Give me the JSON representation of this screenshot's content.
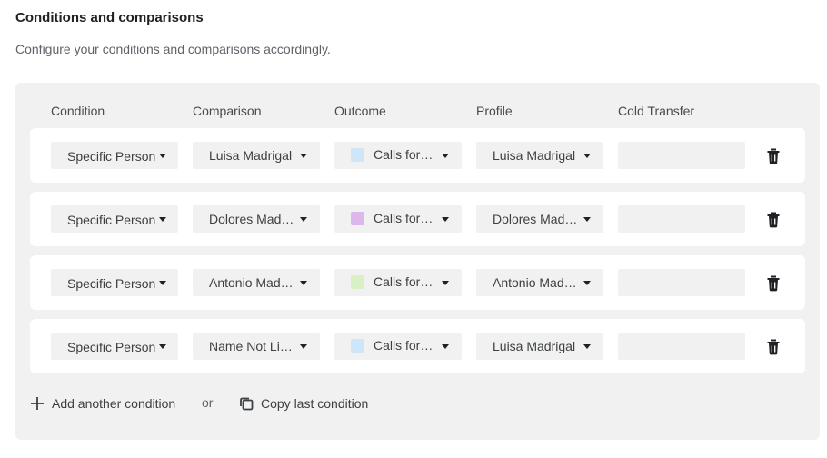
{
  "header": {
    "title": "Conditions and comparisons",
    "subtitle": "Configure your conditions and comparisons accordingly."
  },
  "columns": {
    "condition": "Condition",
    "comparison": "Comparison",
    "outcome": "Outcome",
    "profile": "Profile",
    "cold_transfer": "Cold Transfer"
  },
  "rows": [
    {
      "condition": "Specific Person",
      "comparison": "Luisa Madrigal",
      "outcome": "Calls for ...",
      "outcome_color": "#cfe6f9",
      "profile": "Luisa Madrigal",
      "cold_transfer": ""
    },
    {
      "condition": "Specific Person",
      "comparison": "Dolores Madrigal",
      "outcome": "Calls for ...",
      "outcome_color": "#dcb7ec",
      "profile": "Dolores Madrigal",
      "cold_transfer": ""
    },
    {
      "condition": "Specific Person",
      "comparison": "Antonio Madrigal",
      "outcome": "Calls for ...",
      "outcome_color": "#d8f0c4",
      "profile": "Antonio Madrigal",
      "cold_transfer": ""
    },
    {
      "condition": "Specific Person",
      "comparison": "Name Not Listed",
      "outcome": "Calls for ...",
      "outcome_color": "#cfe6f9",
      "profile": "Luisa Madrigal",
      "cold_transfer": ""
    }
  ],
  "footer": {
    "add_label": "Add another condition",
    "or_label": "or",
    "copy_label": "Copy last condition"
  },
  "icons": {
    "add": "plus-icon",
    "copy": "copy-icon",
    "delete": "trash-icon",
    "dropdown": "caret-down-icon"
  }
}
